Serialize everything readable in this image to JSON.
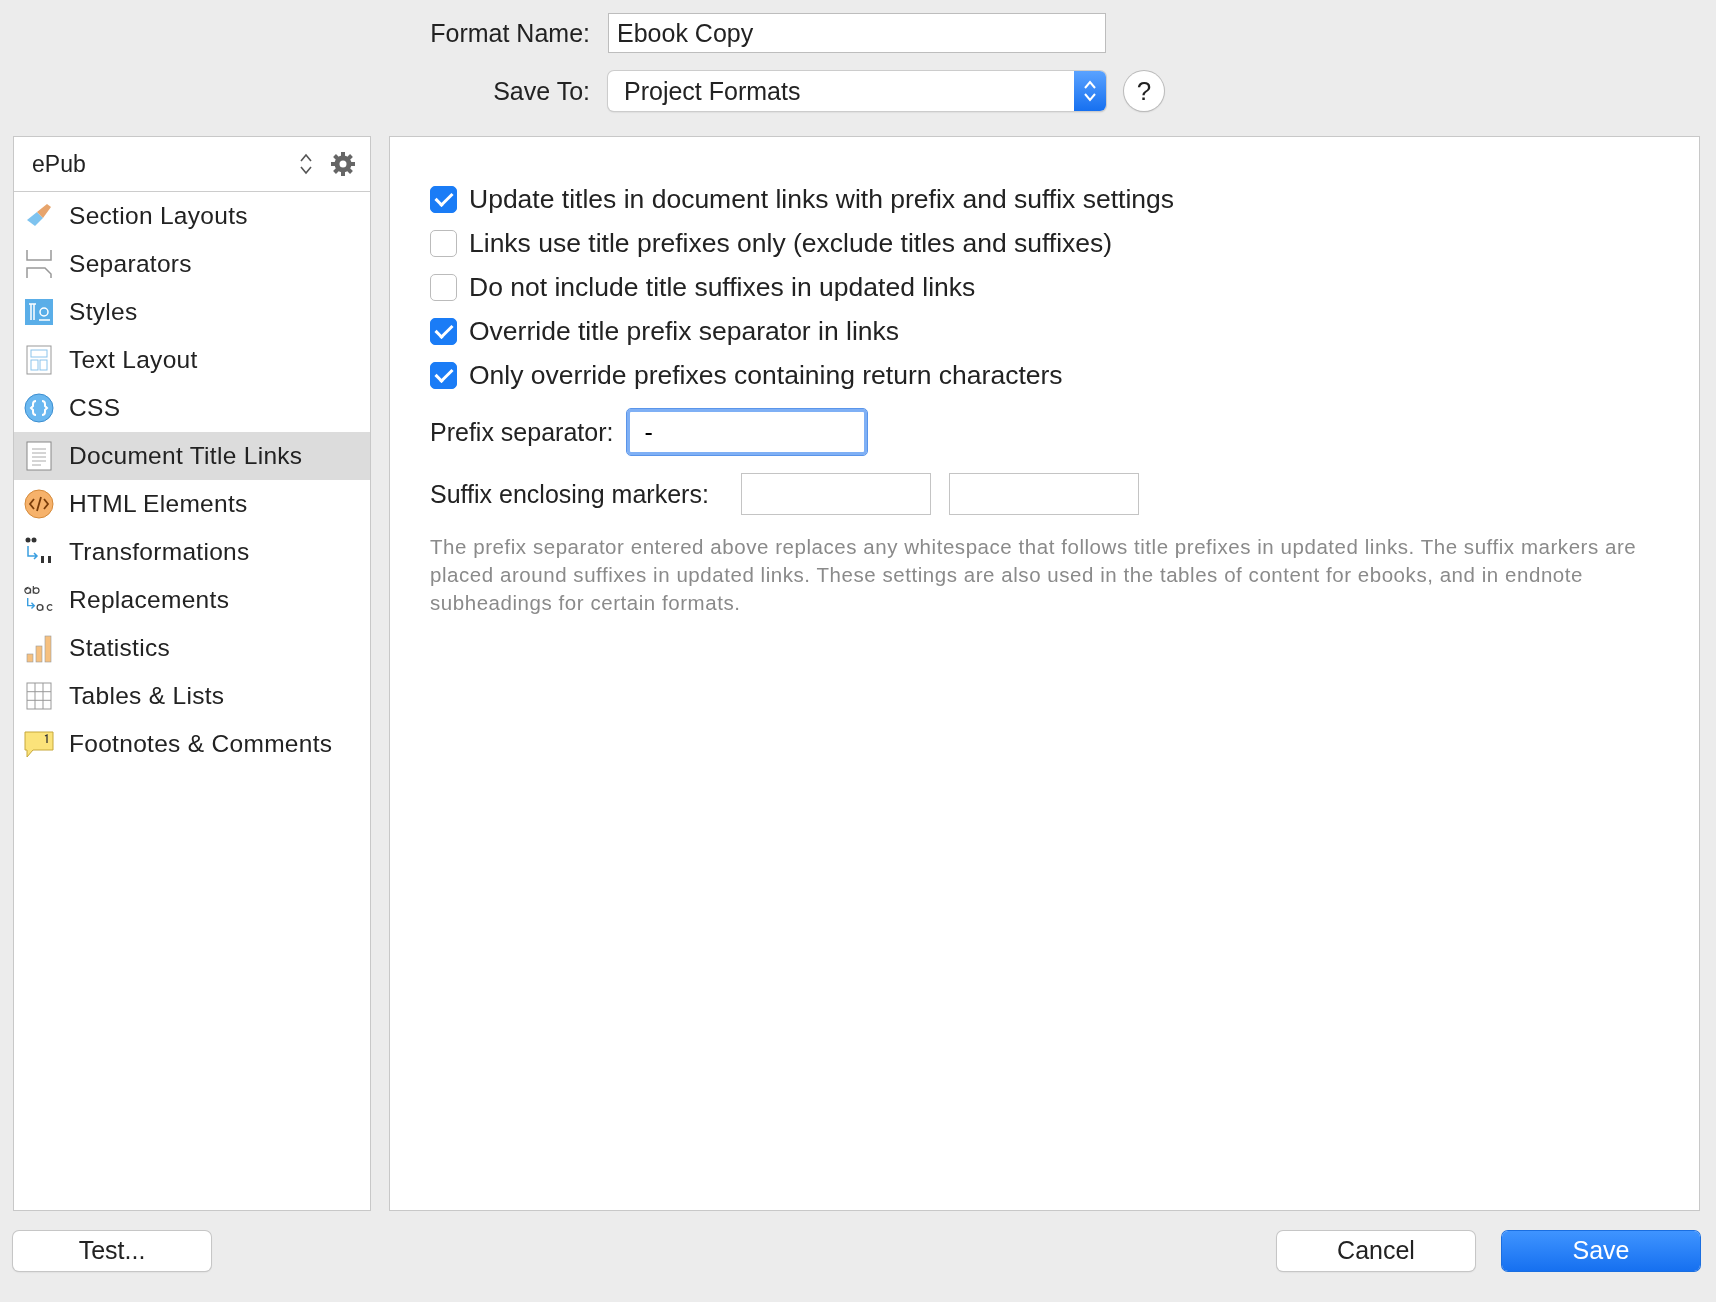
{
  "format_name": {
    "label": "Format Name:",
    "value": "Ebook Copy"
  },
  "save_to": {
    "label": "Save To:",
    "value": "Project Formats"
  },
  "help_button": "?",
  "sidebar": {
    "format": "ePub",
    "items": [
      {
        "label": "Section Layouts",
        "selected": false
      },
      {
        "label": "Separators",
        "selected": false
      },
      {
        "label": "Styles",
        "selected": false
      },
      {
        "label": "Text Layout",
        "selected": false
      },
      {
        "label": "CSS",
        "selected": false
      },
      {
        "label": "Document Title Links",
        "selected": true
      },
      {
        "label": "HTML Elements",
        "selected": false
      },
      {
        "label": "Transformations",
        "selected": false
      },
      {
        "label": "Replacements",
        "selected": false
      },
      {
        "label": "Statistics",
        "selected": false
      },
      {
        "label": "Tables & Lists",
        "selected": false
      },
      {
        "label": "Footnotes & Comments",
        "selected": false
      }
    ]
  },
  "options": [
    {
      "label": "Update titles in document links with prefix and suffix settings",
      "checked": true
    },
    {
      "label": "Links use title prefixes only (exclude titles and suffixes)",
      "checked": false
    },
    {
      "label": "Do not include title suffixes in updated links",
      "checked": false
    },
    {
      "label": "Override title prefix separator in links",
      "checked": true
    },
    {
      "label": "Only override prefixes containing return characters",
      "checked": true
    }
  ],
  "prefix_separator": {
    "label": "Prefix separator:",
    "value": "-"
  },
  "suffix_markers": {
    "label": "Suffix enclosing markers:"
  },
  "help_text": "The prefix separator entered above replaces any whitespace that follows title prefixes in updated links. The suffix markers are placed around suffixes in updated links. These settings are also used in the tables of content for ebooks, and in endnote subheadings for certain formats.",
  "buttons": {
    "test": "Test...",
    "cancel": "Cancel",
    "save": "Save"
  }
}
